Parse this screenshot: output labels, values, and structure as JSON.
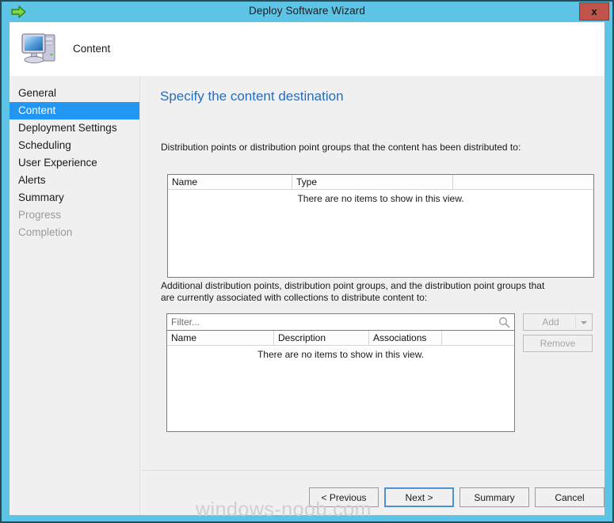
{
  "window": {
    "title": "Deploy Software Wizard",
    "title_icon": "green-arrow-icon",
    "close_label": "x",
    "accent_titlebar_color": "#5ec4e6",
    "accent_selection_color": "#2196f3",
    "heading_color": "#2b6cb8"
  },
  "header": {
    "icon": "computer-icon",
    "title": "Content"
  },
  "sidebar": {
    "items": [
      {
        "label": "General",
        "state": "normal"
      },
      {
        "label": "Content",
        "state": "selected"
      },
      {
        "label": "Deployment Settings",
        "state": "normal"
      },
      {
        "label": "Scheduling",
        "state": "normal"
      },
      {
        "label": "User Experience",
        "state": "normal"
      },
      {
        "label": "Alerts",
        "state": "normal"
      },
      {
        "label": "Summary",
        "state": "normal"
      },
      {
        "label": "Progress",
        "state": "disabled"
      },
      {
        "label": "Completion",
        "state": "disabled"
      }
    ]
  },
  "content": {
    "heading": "Specify the content destination",
    "description_1": "Distribution points or distribution point groups that the content has been distributed to:",
    "description_2": "Additional distribution points, distribution point groups, and the distribution point groups that are currently associated with collections to distribute content to:",
    "distributed_list": {
      "columns": [
        "Name",
        "Type"
      ],
      "rows": [],
      "empty_message": "There are no items to show in this view."
    },
    "filter": {
      "value": "",
      "placeholder": "Filter...",
      "icon": "search-icon"
    },
    "additional_list": {
      "columns": [
        "Name",
        "Description",
        "Associations"
      ],
      "rows": [],
      "empty_message": "There are no items to show in this view."
    },
    "side_buttons": {
      "add_label": "Add",
      "add_enabled": false,
      "add_has_dropdown": true,
      "remove_label": "Remove",
      "remove_enabled": false
    }
  },
  "footer": {
    "previous_label": "< Previous",
    "next_label": "Next >",
    "summary_label": "Summary",
    "cancel_label": "Cancel",
    "focused_button": "Next >"
  },
  "watermark": {
    "text": "windows-noob.com"
  }
}
